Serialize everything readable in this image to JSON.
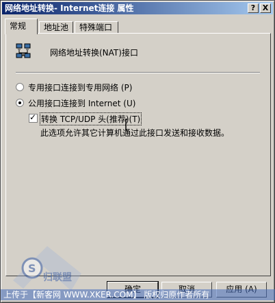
{
  "window": {
    "title": "网络地址转换- Internet连接 属性",
    "help_label": "?",
    "close_label": "X"
  },
  "tabs": [
    {
      "label": "常规"
    },
    {
      "label": "地址池"
    },
    {
      "label": "特殊端口"
    }
  ],
  "header": {
    "icon": "network-computers-icon",
    "title": "网络地址转换(NAT)接口"
  },
  "options": {
    "private_label": "专用接口连接到专用网络 (P)",
    "public_label": "公用接口连接到 Internet (U)",
    "translate_label": "转换 TCP/UDP 头(推荐)(T)",
    "translate_checked": true,
    "description": "此选项允许其它计算机通过此接口发送和接收数据。"
  },
  "buttons": {
    "ok": "确定",
    "cancel": "取消",
    "apply": "应用 (A)"
  },
  "watermark": {
    "text": "上传于【新客网 WWW.XKER.COM】 版权归原作者所有",
    "logo_text": "S 归联盟",
    "logo_url": "www.xker.com"
  },
  "colors": {
    "title_gradient_start": "#0a246a",
    "title_gradient_end": "#a6caf0",
    "face": "#d4d0c8"
  }
}
